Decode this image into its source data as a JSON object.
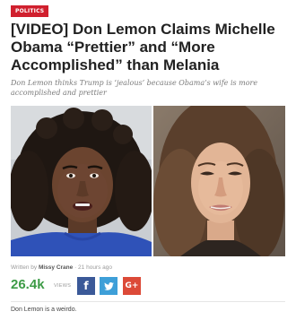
{
  "article": {
    "category": "POLITICS",
    "headline": "[VIDEO] Don Lemon Claims Michelle Obama “Prettier” and “More Accomplished” than Melania",
    "subtitle": "Don Lemon thinks Trump is ‘jealous’ because Obama’s wife is more accomplished and prettier",
    "byline": {
      "prefix": "Written by",
      "author": "Missy Crane",
      "separator": "·",
      "time": "21 hours ago"
    },
    "views": {
      "count": "26.4k",
      "label": "VIEWS"
    },
    "share": {
      "facebook_glyph": "f",
      "twitter_glyph": "❧",
      "google_glyph": "G+"
    },
    "body_first_line": "Don Lemon is a weirdo."
  },
  "icons": {
    "facebook": "facebook-icon",
    "twitter": "twitter-icon",
    "google": "google-plus-icon"
  },
  "colors": {
    "category_badge": "#d0202e",
    "views_count": "#3d9b46",
    "facebook": "#3b5998",
    "twitter": "#3e9fd8",
    "google_plus": "#dc4a38"
  }
}
